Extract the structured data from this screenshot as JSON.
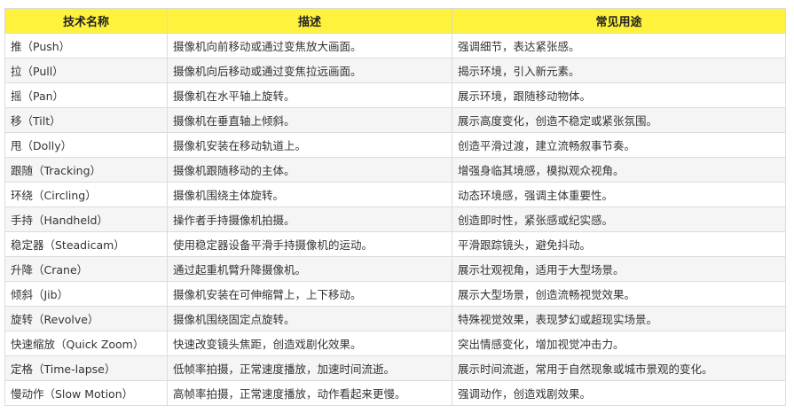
{
  "table": {
    "headers": [
      "技术名称",
      "描述",
      "常见用途"
    ],
    "rows": [
      [
        "推（Push）",
        "摄像机向前移动或通过变焦放大画面。",
        "强调细节，表达紧张感。"
      ],
      [
        "拉（Pull）",
        "摄像机向后移动或通过变焦拉远画面。",
        "揭示环境，引入新元素。"
      ],
      [
        "摇（Pan）",
        "摄像机在水平轴上旋转。",
        "展示环境，跟随移动物体。"
      ],
      [
        "移（Tilt）",
        "摄像机在垂直轴上倾斜。",
        "展示高度变化，创造不稳定或紧张氛围。"
      ],
      [
        "甩（Dolly）",
        "摄像机安装在移动轨道上。",
        "创造平滑过渡，建立流畅叙事节奏。"
      ],
      [
        "跟随（Tracking）",
        "摄像机跟随移动的主体。",
        "增强身临其境感，模拟观众视角。"
      ],
      [
        "环绕（Circling）",
        "摄像机围绕主体旋转。",
        "动态环境感，强调主体重要性。"
      ],
      [
        "手持（Handheld）",
        "操作者手持摄像机拍摄。",
        "创造即时性，紧张感或纪实感。"
      ],
      [
        "稳定器（Steadicam）",
        "使用稳定器设备平滑手持摄像机的运动。",
        "平滑跟踪镜头，避免抖动。"
      ],
      [
        "升降（Crane）",
        "通过起重机臂升降摄像机。",
        "展示壮观视角，适用于大型场景。"
      ],
      [
        "倾斜（Jib）",
        "摄像机安装在可伸缩臂上，上下移动。",
        "展示大型场景，创造流畅视觉效果。"
      ],
      [
        "旋转（Revolve）",
        "摄像机围绕固定点旋转。",
        "特殊视觉效果，表现梦幻或超现实场景。"
      ],
      [
        "快速缩放（Quick Zoom）",
        "快速改变镜头焦距，创造戏剧化效果。",
        "突出情感变化，增加视觉冲击力。"
      ],
      [
        "定格（Time-lapse）",
        "低帧率拍摄，正常速度播放，加速时间流逝。",
        "展示时间流逝，常用于自然现象或城市景观的变化。"
      ],
      [
        "慢动作（Slow Motion）",
        "高帧率拍摄，正常速度播放，动作看起来更慢。",
        "强调动作，创造戏剧效果。"
      ]
    ]
  },
  "colors": {
    "header_bg": "#fef23c",
    "stripe_bg": "#f5f5f5",
    "border": "#dcdcdc"
  }
}
